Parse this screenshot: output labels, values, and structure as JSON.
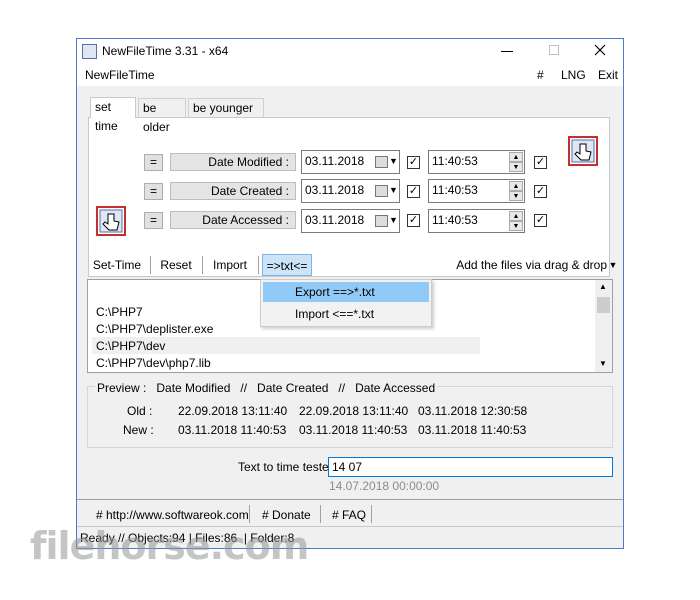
{
  "window": {
    "title": "NewFileTime 3.31 - x64"
  },
  "menu": {
    "left": "NewFileTime",
    "hash": "#",
    "lng": "LNG",
    "exit": "Exit"
  },
  "tabs": [
    "set time",
    "be older",
    "be younger"
  ],
  "rows": [
    {
      "eq": "=",
      "label": "Date Modified :",
      "date": "03.11.2018",
      "time": "11:40:53"
    },
    {
      "eq": "=",
      "label": "Date Created :",
      "date": "03.11.2018",
      "time": "11:40:53"
    },
    {
      "eq": "=",
      "label": "Date Accessed :",
      "date": "03.11.2018",
      "time": "11:40:53"
    }
  ],
  "toolbar": {
    "set_time": "Set-Time",
    "reset": "Reset",
    "import": "Import",
    "txt": "=>txt<=",
    "drag": "Add the files via drag & drop"
  },
  "dropdown": {
    "export": "Export ==>*.txt",
    "import": "Import <==*.txt"
  },
  "files": [
    "C:\\PHP7",
    "C:\\PHP7\\deplister.exe",
    "C:\\PHP7\\dev",
    "C:\\PHP7\\dev\\php7.lib"
  ],
  "preview": {
    "header": "Preview :   Date Modified   //   Date Created   //   Date Accessed",
    "old_label": "Old :",
    "new_label": "New :",
    "old": [
      "22.09.2018 13:11:40",
      "22.09.2018 13:11:40",
      "03.11.2018 12:30:58"
    ],
    "new": [
      "03.11.2018 11:40:53",
      "03.11.2018 11:40:53",
      "03.11.2018 11:40:53"
    ]
  },
  "tester": {
    "label": "Text to time tester",
    "value": "14 07",
    "result": "14.07.2018 00:00:00"
  },
  "links": [
    "# http://www.softwareok.com",
    "# Donate",
    "# FAQ"
  ],
  "status": "Ready // Objects:94 | Files:86  | Folder:8",
  "watermark": "filehorse.com"
}
